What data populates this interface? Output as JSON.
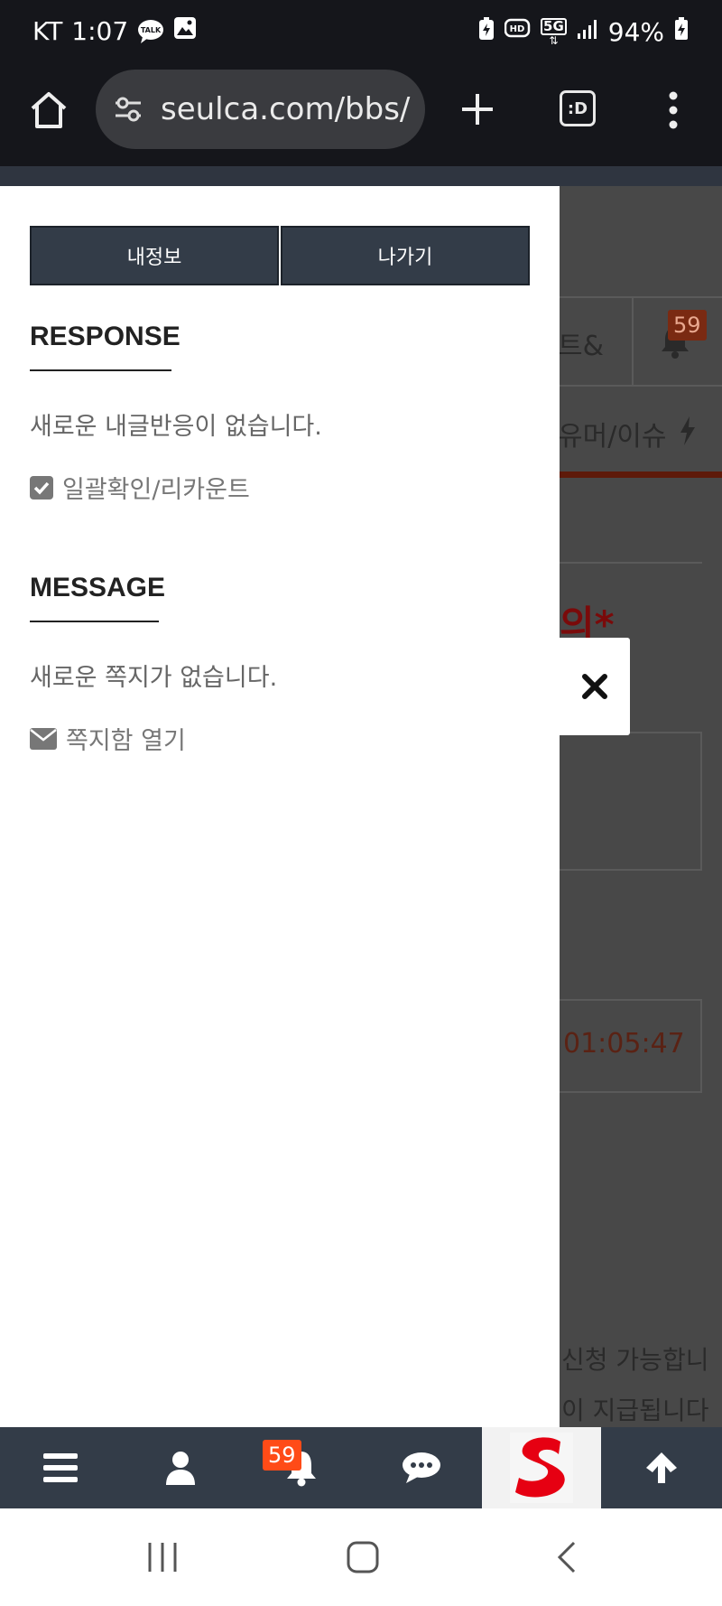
{
  "status_bar": {
    "carrier": "KT",
    "time": "1:07",
    "talk_badge": "TALK",
    "network": "5G",
    "battery": "94%"
  },
  "browser": {
    "url": "seulca.com/bbs/",
    "tabs_label": ":D"
  },
  "background_page": {
    "tab_partial": "트&",
    "bell_badge": "59",
    "category_partial": "유머/이슈",
    "title_partial": "의*",
    "timer": "01:05:47",
    "line1": "신청 가능합니",
    "line2": "이 지급됩니다"
  },
  "drawer": {
    "my_info_label": "내정보",
    "logout_label": "나가기",
    "response": {
      "title": "RESPONSE",
      "empty_text": "새로운 내글반응이 없습니다.",
      "link_label": "일괄확인/리카운트"
    },
    "message": {
      "title": "MESSAGE",
      "empty_text": "새로운 쪽지가 없습니다.",
      "link_label": "쪽지함 열기"
    }
  },
  "bottom_nav": {
    "notification_badge": "59"
  },
  "colors": {
    "drawer_button_bg": "#333c48",
    "badge": "#ff4b17",
    "logo_red": "#e60012"
  }
}
